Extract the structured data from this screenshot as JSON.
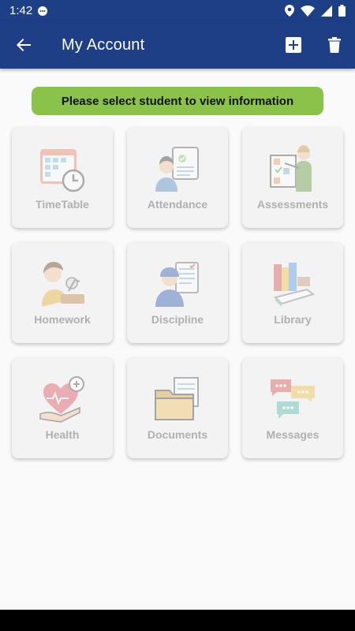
{
  "status": {
    "time": "1:42"
  },
  "app_bar": {
    "title": "My Account"
  },
  "banner": {
    "text": "Please select student to view information"
  },
  "tiles": [
    {
      "label": "TimeTable",
      "icon": "timetable-icon"
    },
    {
      "label": "Attendance",
      "icon": "attendance-icon"
    },
    {
      "label": "Assessments",
      "icon": "assessments-icon"
    },
    {
      "label": "Homework",
      "icon": "homework-icon"
    },
    {
      "label": "Discipline",
      "icon": "discipline-icon"
    },
    {
      "label": "Library",
      "icon": "library-icon"
    },
    {
      "label": "Health",
      "icon": "health-icon"
    },
    {
      "label": "Documents",
      "icon": "documents-icon"
    },
    {
      "label": "Messages",
      "icon": "messages-icon"
    }
  ],
  "colors": {
    "primary": "#1e3f86",
    "banner": "#8bc34a",
    "tile_bg": "#f3f3f3",
    "tile_label": "#b0b0b0"
  }
}
